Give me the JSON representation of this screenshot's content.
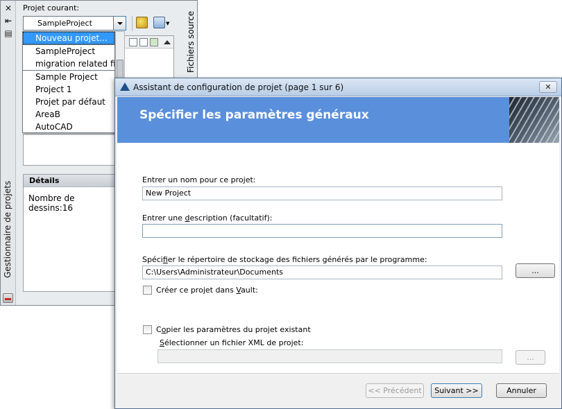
{
  "palette": {
    "title": "Gestionnaire de projets",
    "current_project_label": "Projet courant:",
    "current_project_value": "SampleProject",
    "source_files_label": "Fichiers source",
    "project_list": [
      "Nouveau projet...",
      "SampleProject",
      "migration related files",
      "Sample Project",
      "Project 1",
      "Projet par défaut",
      "AreaB",
      "AutoCAD"
    ],
    "details": {
      "heading": "Détails",
      "drawing_count": "Nombre de dessins:16"
    },
    "icons": [
      "close-icon",
      "pin-icon",
      "properties-icon",
      "manager-icon"
    ]
  },
  "dialog": {
    "title": "Assistant de configuration de projet (page 1 sur 6)",
    "close_symbol": "✕",
    "banner_title": "Spécifier les paramètres généraux",
    "name_label": "Entrer un nom pour ce projet:",
    "name_value": "New Project",
    "desc_label_pre": "Entrer une ",
    "desc_label_u": "d",
    "desc_label_post": "escription (facultatif):",
    "desc_value": "",
    "dir_label_pre": "Spéci",
    "dir_label_u": "f",
    "dir_label_post": "ier le répertoire de stockage des fichiers générés par le programme:",
    "dir_value": "C:\\Users\\Administrateur\\Documents",
    "browse_label": "...",
    "vault_label_pre": "Créer ce projet dans ",
    "vault_label_u": "V",
    "vault_label_post": "ault:",
    "copy_label_pre": "C",
    "copy_label_u": "o",
    "copy_label_post": "pier les paramètres du projet existant",
    "xml_label_pre": "",
    "xml_label_u": "S",
    "xml_label_post": "électionner un fichier XML de projet:",
    "xml_value": "",
    "xml_browse_label": "...",
    "btn_prev": "<< Précédent",
    "btn_next": "Suivant >>",
    "btn_cancel": "Annuler"
  },
  "colors": {
    "banner": "#5a8fdc",
    "selection": "#3399ff"
  }
}
